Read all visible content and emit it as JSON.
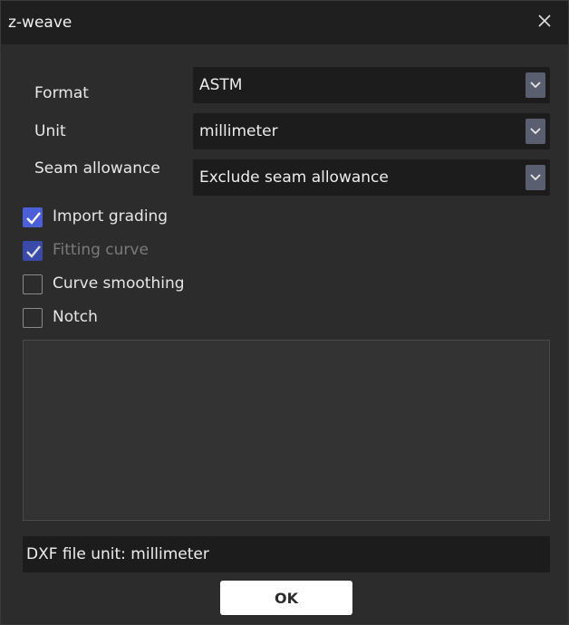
{
  "window": {
    "title": "z-weave",
    "close_icon": "close-icon"
  },
  "form": {
    "format": {
      "label": "Format",
      "value": "ASTM"
    },
    "unit": {
      "label": "Unit",
      "value": "millimeter"
    },
    "seam_allowance": {
      "label": "Seam allowance",
      "value": "Exclude seam allowance"
    }
  },
  "options": {
    "import_grading": {
      "label": "Import grading",
      "checked": true,
      "enabled": true
    },
    "fitting_curve": {
      "label": "Fitting curve",
      "checked": true,
      "enabled": false
    },
    "curve_smoothing": {
      "label": "Curve smoothing",
      "checked": false,
      "enabled": true
    },
    "notch": {
      "label": "Notch",
      "checked": false,
      "enabled": true
    }
  },
  "info": {
    "dxf_unit": "DXF file unit: millimeter"
  },
  "footer": {
    "ok_label": "OK"
  },
  "colors": {
    "accent": "#4b5fd8",
    "titlebar": "#1f1f1f",
    "background": "#2c2c2c"
  }
}
